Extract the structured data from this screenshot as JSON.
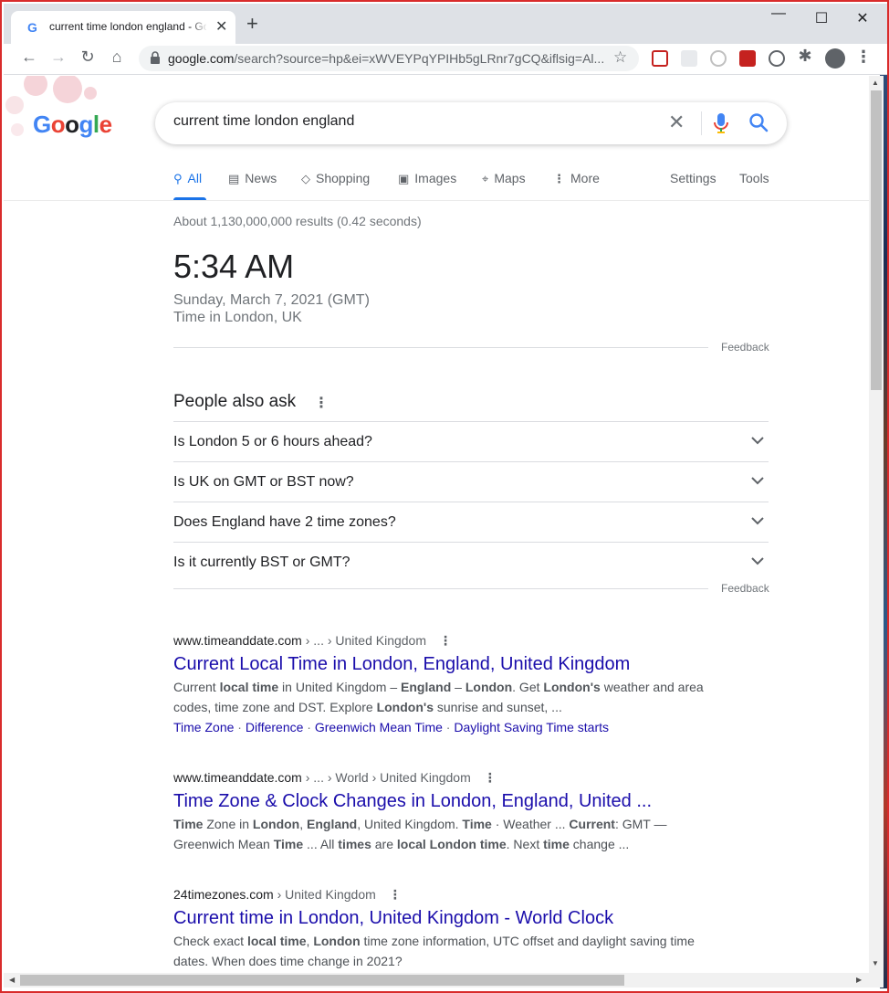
{
  "browser": {
    "tab_title": "current time london england - Google Search",
    "favicon": "G",
    "new_tab": "+",
    "url_host": "google.com",
    "url_rest": "/search?source=hp&ei=xWVEYPqYPIHb5gLRnr7gCQ&iflsig=Al..."
  },
  "google": {
    "logo_letters": [
      "G",
      "o",
      "o",
      "g",
      "l",
      "e"
    ],
    "logo_colors": [
      "#4285f4",
      "#ea4335",
      "#202124",
      "#4285f4",
      "#34a853",
      "#ea4335"
    ],
    "query": "current time london england",
    "tabs": [
      {
        "label": "All",
        "icon": "search-icon"
      },
      {
        "label": "News",
        "icon": "news-icon"
      },
      {
        "label": "Shopping",
        "icon": "tag-icon"
      },
      {
        "label": "Images",
        "icon": "image-icon"
      },
      {
        "label": "Maps",
        "icon": "map-pin-icon"
      },
      {
        "label": "More",
        "icon": "more-vert-icon"
      },
      {
        "label": "Settings"
      },
      {
        "label": "Tools"
      }
    ],
    "stats": "About 1,130,000,000 results (0.42 seconds)",
    "clock": {
      "time": "5:34 AM",
      "date": "Sunday, March 7, 2021 (GMT)",
      "place": "Time in London, UK"
    },
    "feedback": "Feedback",
    "paa": {
      "title": "People also ask",
      "questions": [
        "Is London 5 or 6 hours ahead?",
        "Is UK on GMT or BST now?",
        "Does England have 2 time zones?",
        "Is it currently BST or GMT?"
      ]
    },
    "results": [
      {
        "site": "www.timeanddate.com",
        "crumbs": " › ... › United Kingdom",
        "title": "Current Local Time in London, England, United Kingdom",
        "snippet": [
          {
            "t": "Current "
          },
          {
            "t": "local time",
            "b": true
          },
          {
            "t": " in United Kingdom – "
          },
          {
            "t": "England",
            "b": true
          },
          {
            "t": " – "
          },
          {
            "t": "London",
            "b": true
          },
          {
            "t": ". Get "
          },
          {
            "t": "London's",
            "b": true
          },
          {
            "t": " weather and area codes, time zone and DST. Explore "
          },
          {
            "t": "London's",
            "b": true
          },
          {
            "t": " sunrise and sunset, ..."
          }
        ],
        "sitelinks": [
          "Time Zone",
          "Difference",
          "Greenwich Mean Time",
          "Daylight Saving Time starts"
        ]
      },
      {
        "site": "www.timeanddate.com",
        "crumbs": " › ... › World › United Kingdom",
        "title": "Time Zone & Clock Changes in London, England, United ...",
        "snippet": [
          {
            "t": "Time",
            "b": true
          },
          {
            "t": " Zone in "
          },
          {
            "t": "London",
            "b": true
          },
          {
            "t": ", "
          },
          {
            "t": "England",
            "b": true
          },
          {
            "t": ", United Kingdom. "
          },
          {
            "t": "Time",
            "b": true
          },
          {
            "t": " · Weather ... "
          },
          {
            "t": "Current",
            "b": true
          },
          {
            "t": ": GMT — Greenwich Mean "
          },
          {
            "t": "Time",
            "b": true
          },
          {
            "t": " ... All "
          },
          {
            "t": "times",
            "b": true
          },
          {
            "t": " are "
          },
          {
            "t": "local London time",
            "b": true
          },
          {
            "t": ". Next "
          },
          {
            "t": "time",
            "b": true
          },
          {
            "t": " change ..."
          }
        ],
        "sitelinks": []
      },
      {
        "site": "24timezones.com",
        "crumbs": " › United Kingdom",
        "title": "Current time in London, United Kingdom - World Clock",
        "snippet": [
          {
            "t": "Check exact "
          },
          {
            "t": "local time",
            "b": true
          },
          {
            "t": ", "
          },
          {
            "t": "London",
            "b": true
          },
          {
            "t": " time zone information, UTC offset and daylight saving time dates. When does time change in 2021?"
          }
        ],
        "sitelinks": []
      }
    ]
  }
}
